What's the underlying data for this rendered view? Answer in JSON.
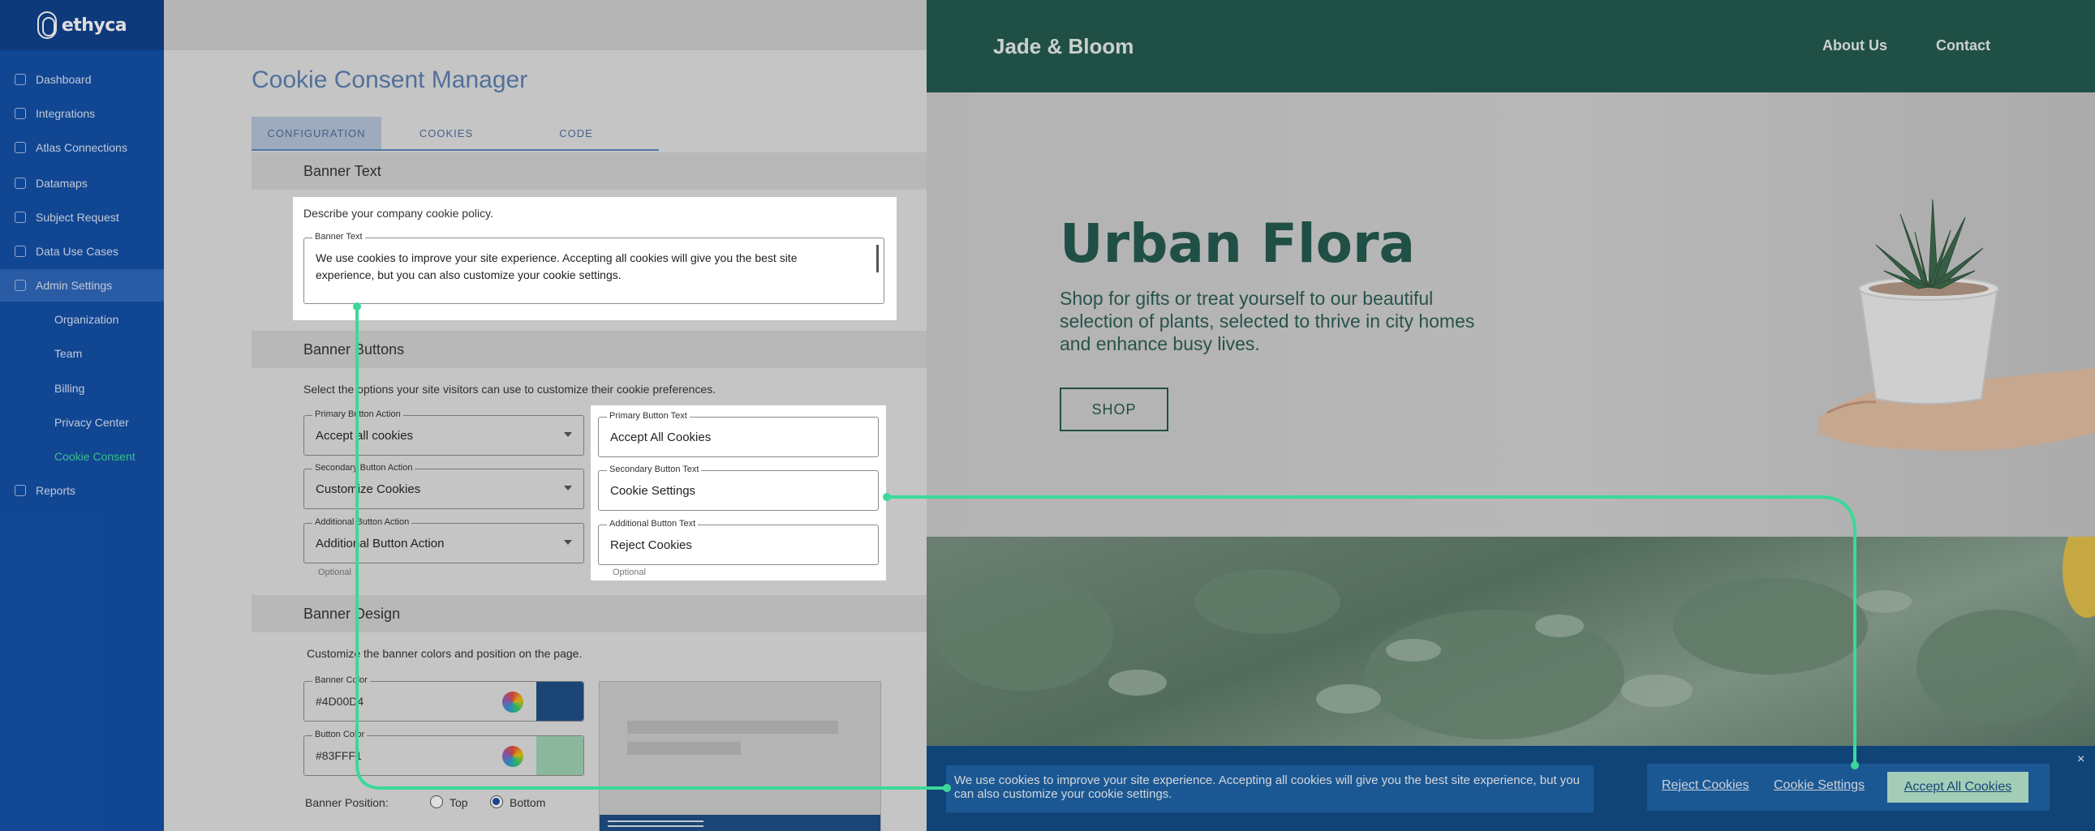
{
  "brand": {
    "name": "ethyca"
  },
  "sidebar": {
    "items": [
      {
        "label": "Dashboard",
        "icon": "dashboard-icon"
      },
      {
        "label": "Integrations",
        "icon": "integrations-icon"
      },
      {
        "label": "Atlas Connections",
        "icon": "atlas-icon"
      },
      {
        "label": "Datamaps",
        "icon": "datamaps-icon"
      },
      {
        "label": "Subject Request",
        "icon": "subject-request-icon"
      },
      {
        "label": "Data Use Cases",
        "icon": "data-use-icon"
      },
      {
        "label": "Admin Settings",
        "icon": "settings-icon"
      },
      {
        "label": "Organization"
      },
      {
        "label": "Team"
      },
      {
        "label": "Billing"
      },
      {
        "label": "Privacy Center"
      },
      {
        "label": "Cookie Consent"
      },
      {
        "label": "Reports",
        "icon": "reports-icon"
      }
    ]
  },
  "main": {
    "title": "Cookie Consent Manager",
    "tabs": [
      "CONFIGURATION",
      "COOKIES",
      "CODE"
    ],
    "banner_text": {
      "heading": "Banner Text",
      "helper": "Describe your company cookie policy.",
      "field_label": "Banner Text",
      "field_value": "We use cookies to improve your site experience. Accepting all cookies will give you the best site experience, but you can also customize your cookie settings."
    },
    "banner_buttons": {
      "heading": "Banner Buttons",
      "helper": "Select the options your site visitors can use to customize their cookie preferences.",
      "primary_action_label": "Primary Button Action",
      "primary_action_value": "Accept all cookies",
      "secondary_action_label": "Secondary Button Action",
      "secondary_action_value": "Customize Cookies",
      "additional_action_label": "Additional Button Action",
      "additional_action_value": "Additional Button Action",
      "primary_text_label": "Primary Button Text",
      "primary_text_value": "Accept All Cookies",
      "secondary_text_label": "Secondary Button Text",
      "secondary_text_value": "Cookie Settings",
      "additional_text_label": "Additional Button Text",
      "additional_text_value": "Reject Cookies",
      "optional": "Optional"
    },
    "banner_design": {
      "heading": "Banner Design",
      "helper": "Customize the banner colors and position on the page.",
      "banner_color_label": "Banner Color",
      "banner_color_value": "#4D00D4",
      "banner_color_swatch": "#1c4d84",
      "button_color_label": "Button Color",
      "button_color_value": "#83FFF1",
      "button_color_swatch": "#9fd3b3",
      "position_label": "Banner Position:",
      "position_top": "Top",
      "position_bottom": "Bottom",
      "position_selected": "Bottom"
    }
  },
  "site": {
    "logo": "Jade & Bloom",
    "nav": [
      "About Us",
      "Contact"
    ],
    "hero_title": "Urban Flora",
    "hero_subtitle": "Shop for gifts or treat yourself to our beautiful selection of plants, selected to thrive in city homes and enhance busy lives.",
    "shop_button": "SHOP",
    "cookie_banner": {
      "message": "We use cookies to improve your site experience. Accepting all cookies will give you the best site experience, but you can also customize your cookie settings.",
      "reject": "Reject Cookies",
      "settings": "Cookie Settings",
      "accept": "Accept All Cookies",
      "close": "×"
    }
  },
  "colors": {
    "sidebar": "#114fa8",
    "site_header": "#225a4d",
    "connector": "#3cd89a",
    "banner": "#114c86",
    "accept_button": "#bcecd3"
  }
}
